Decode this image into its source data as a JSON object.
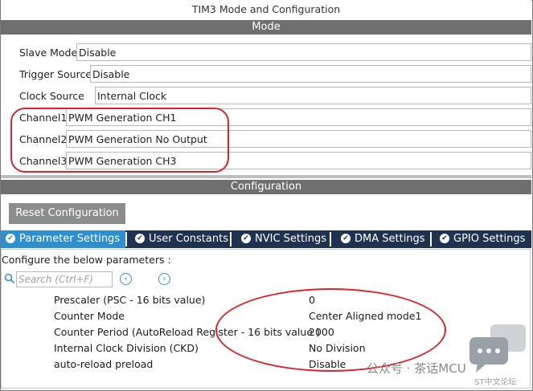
{
  "window": {
    "title": "TIM3 Mode and Configuration"
  },
  "mode": {
    "header": "Mode",
    "fields": [
      {
        "label": "Slave Mode",
        "value": "Disable"
      },
      {
        "label": "Trigger Source",
        "value": "Disable"
      },
      {
        "label": "Clock Source",
        "value": "Internal Clock"
      },
      {
        "label": "Channel1",
        "value": "PWM Generation CH1"
      },
      {
        "label": "Channel2",
        "value": "PWM Generation No Output"
      },
      {
        "label": "Channel3",
        "value": "PWM Generation CH3"
      }
    ]
  },
  "configuration": {
    "header": "Configuration",
    "reset_label": "Reset Configuration",
    "tabs": [
      {
        "label": "Parameter Settings",
        "active": true
      },
      {
        "label": "User Constants",
        "active": false
      },
      {
        "label": "NVIC Settings",
        "active": false
      },
      {
        "label": "DMA Settings",
        "active": false
      },
      {
        "label": "GPIO Settings",
        "active": false
      }
    ],
    "hint": "Configure the below parameters :",
    "search": {
      "placeholder": "Search (Ctrl+F)"
    },
    "parameters": [
      {
        "name": "Prescaler (PSC - 16 bits value)",
        "value": "0"
      },
      {
        "name": "Counter Mode",
        "value": "Center Aligned mode1"
      },
      {
        "name": "Counter Period (AutoReload Register - 16 bits value )",
        "value": "2000"
      },
      {
        "name": "Internal Clock Division (CKD)",
        "value": "No Division"
      },
      {
        "name": "auto-reload preload",
        "value": "Disable"
      }
    ]
  },
  "watermark": {
    "text": "公众号 · 茶话MCU",
    "sub": "ST中文论坛"
  },
  "colors": {
    "header_gray": "#6f6f6f",
    "tab_dark": "#1f3350",
    "tab_active": "#2e8fd0",
    "annotation_red": "#e0222a",
    "reset_button": "#8c8c8c"
  }
}
